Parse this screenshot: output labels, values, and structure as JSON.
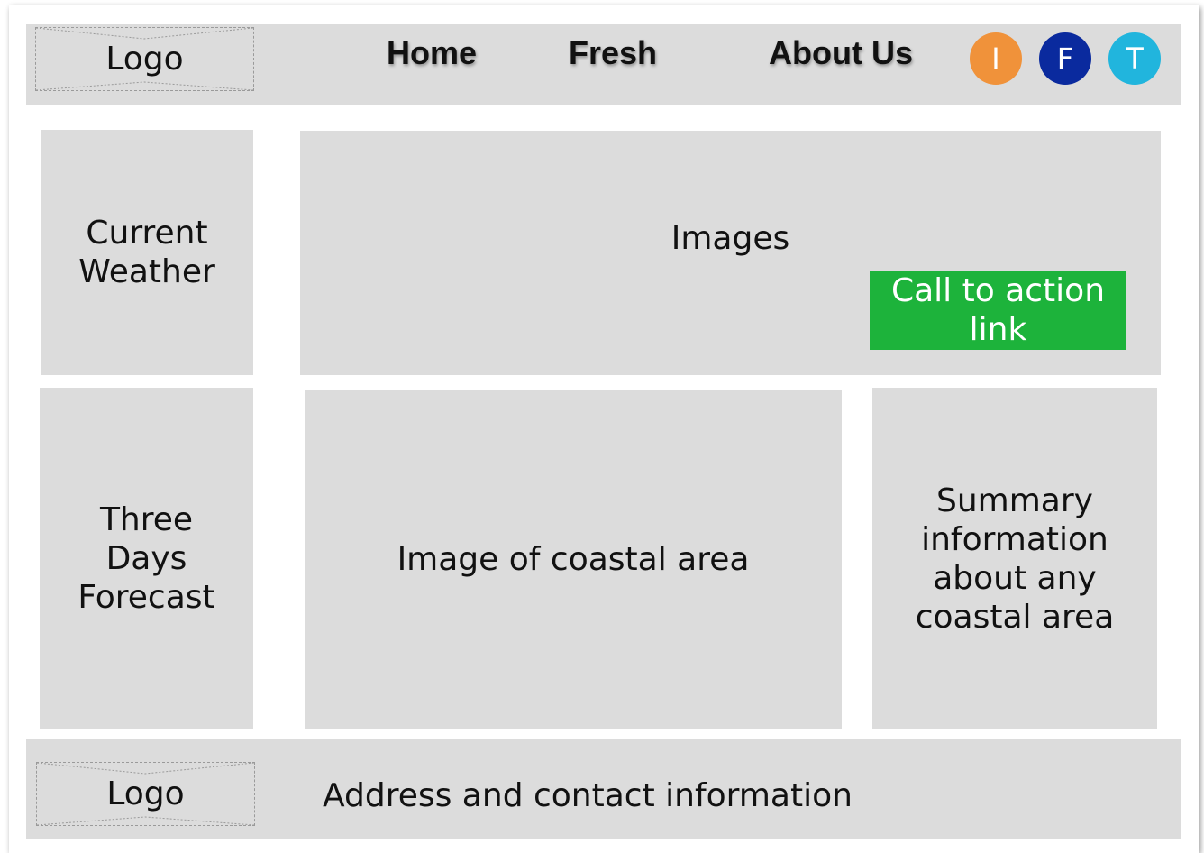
{
  "header": {
    "logo": "Logo",
    "nav": [
      {
        "label": "Home"
      },
      {
        "label": "Fresh"
      },
      {
        "label": "About Us"
      }
    ],
    "social": [
      {
        "letter": "I",
        "color": "#F0923A"
      },
      {
        "letter": "F",
        "color": "#0A2A9E"
      },
      {
        "letter": "T",
        "color": "#21B5DD"
      }
    ]
  },
  "sidebar": {
    "current_weather": [
      "Current",
      "Weather"
    ],
    "forecast": [
      "Three",
      "Days",
      "Forecast"
    ]
  },
  "hero": {
    "label": "Images",
    "cta": [
      "Call to action",
      "link"
    ],
    "cta_color": "#1DB33B"
  },
  "content": {
    "coastal_image": "Image of coastal area",
    "summary": [
      "Summary",
      "information",
      "about any",
      "coastal area"
    ]
  },
  "footer": {
    "logo": "Logo",
    "contact": "Address and contact information"
  }
}
